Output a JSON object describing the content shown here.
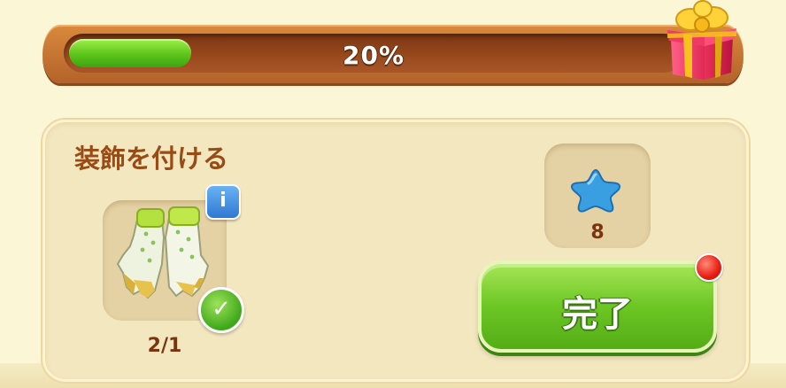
{
  "progress": {
    "percent": 20,
    "label": "20%"
  },
  "task": {
    "title": "装飾を付ける",
    "item_icon": "gardening-gloves-icon",
    "item_count": "2/1",
    "info_icon": "info-icon",
    "completed_icon": "checkmark-icon"
  },
  "reward": {
    "icon": "blue-star-icon",
    "amount": "8"
  },
  "done_button": {
    "label": "完了",
    "notification_icon": "red-dot-icon"
  },
  "colors": {
    "progress_fill": "#5cc41a",
    "bar_frame": "#b4622a",
    "title_text": "#9a4a14",
    "button_green": "#6cc624",
    "notification": "#e81c10"
  }
}
